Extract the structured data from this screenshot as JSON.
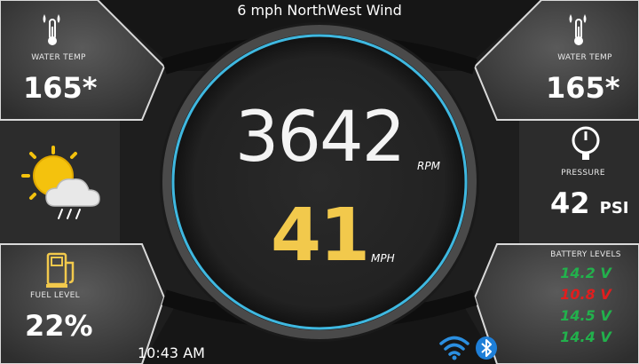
{
  "header": {
    "wind": "6 mph NorthWest Wind"
  },
  "left_temp": {
    "label": "WATER TEMP",
    "value": "165*"
  },
  "right_temp": {
    "label": "WATER TEMP",
    "value": "165*"
  },
  "gauge": {
    "rpm": "3642",
    "rpm_unit": "RPM",
    "speed": "41",
    "speed_unit": "MPH"
  },
  "pressure": {
    "label": "PRESSURE",
    "value": "42",
    "unit": "PSI"
  },
  "fuel": {
    "label": "FUEL LEVEL",
    "value": "22%"
  },
  "battery": {
    "label": "BATTERY LEVELS",
    "levels": [
      "14.2 V",
      "10.8 V",
      "14.5 V",
      "14.4 V"
    ]
  },
  "status": {
    "time": "10:43 AM"
  },
  "colors": {
    "accent_ring": "#3fb8e0",
    "speed": "#f2c94c",
    "battery_ok": "#22b14c",
    "battery_low": "#e01e1e"
  },
  "icons": [
    "thermometer-icon",
    "weather-sun-cloud-rain-icon",
    "pressure-gauge-icon",
    "fuel-pump-icon",
    "wifi-icon",
    "bluetooth-icon"
  ]
}
